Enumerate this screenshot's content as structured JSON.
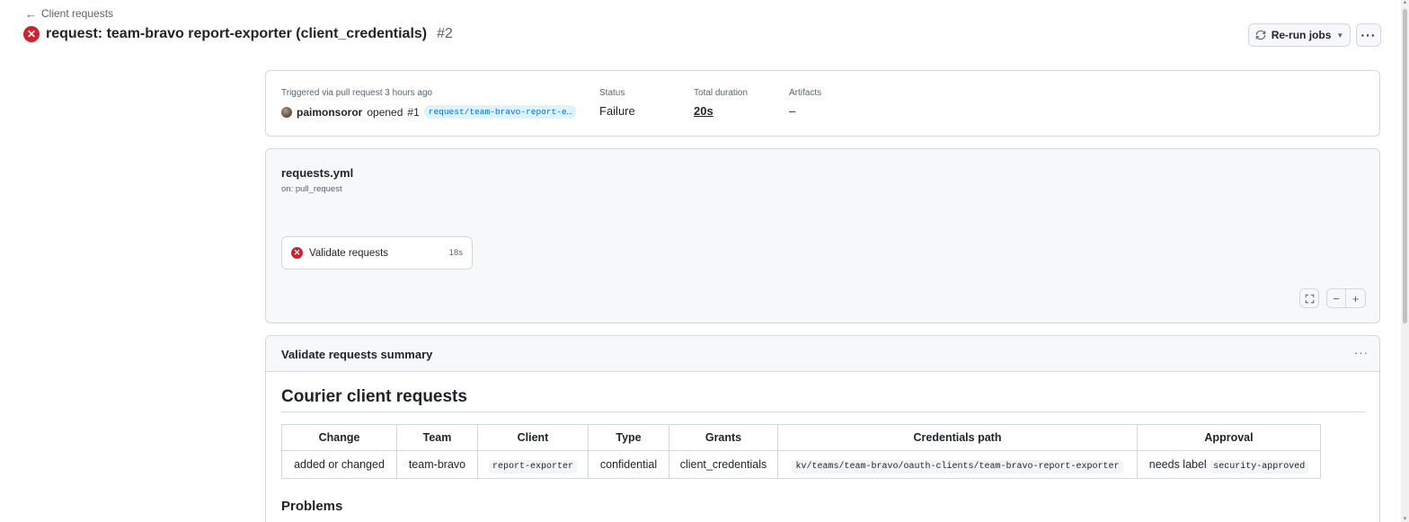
{
  "nav": {
    "back_label": "Client requests"
  },
  "run": {
    "title": "request: team-bravo report-exporter (client_credentials)",
    "number": "#2"
  },
  "actions": {
    "rerun_label": "Re-run jobs",
    "more_label": "···"
  },
  "summary": {
    "trigger_text": "Triggered via pull request 3 hours ago",
    "actor": "paimonsoror",
    "opened_text": "opened",
    "pr_number": "#1",
    "branch": "request/team-bravo-report-e…",
    "status_label": "Status",
    "status_value": "Failure",
    "duration_label": "Total duration",
    "duration_value": "20s",
    "artifacts_label": "Artifacts",
    "artifacts_value": "–"
  },
  "workflow": {
    "file": "requests.yml",
    "trigger": "on: pull_request",
    "job": {
      "name": "Validate requests",
      "duration": "18s"
    },
    "zoom": {
      "fit_icon": "fullscreen-icon",
      "out_icon": "minus-icon",
      "in_icon": "plus-icon"
    }
  },
  "job_summary": {
    "title": "Validate requests summary",
    "heading": "Courier client requests",
    "table": {
      "headers": [
        "Change",
        "Team",
        "Client",
        "Type",
        "Grants",
        "Credentials path",
        "Approval"
      ],
      "row": {
        "change": "added or changed",
        "team": "team-bravo",
        "client": "report-exporter",
        "type": "confidential",
        "grants": "client_credentials",
        "path": "kv/teams/team-bravo/oauth-clients/team-bravo-report-exporter",
        "approval_text": "needs label",
        "approval_label": "security-approved"
      }
    },
    "problems_heading": "Problems"
  },
  "colors": {
    "failure": "#cf222e",
    "branch_bg": "#ddf4ff",
    "link": "#0969da",
    "border": "#d1d9e0",
    "canvas": "#f6f8fa"
  }
}
